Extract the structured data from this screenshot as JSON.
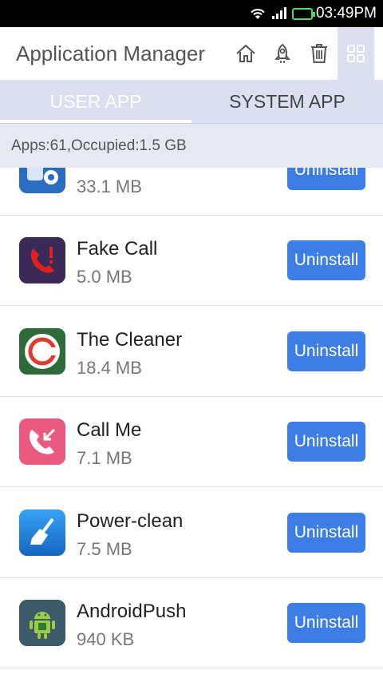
{
  "status_bar": {
    "time": "03:49PM"
  },
  "header": {
    "title": "Application Manager"
  },
  "tabs": [
    {
      "label": "USER APP",
      "active": true
    },
    {
      "label": "SYSTEM APP",
      "active": false
    }
  ],
  "summary": {
    "text": "Apps:61,Occupied:1.5 GB"
  },
  "apps": [
    {
      "name": "",
      "size": "33.1 MB",
      "button": "Uninstall",
      "icon": "blue-gear-app-icon"
    },
    {
      "name": "Fake Call",
      "size": "5.0 MB",
      "button": "Uninstall",
      "icon": "fake-call-icon"
    },
    {
      "name": "The Cleaner",
      "size": "18.4 MB",
      "button": "Uninstall",
      "icon": "cleaner-ring-icon"
    },
    {
      "name": "Call Me",
      "size": "7.1 MB",
      "button": "Uninstall",
      "icon": "call-me-phone-icon"
    },
    {
      "name": "Power-clean",
      "size": "7.5 MB",
      "button": "Uninstall",
      "icon": "broom-icon"
    },
    {
      "name": "AndroidPush",
      "size": "940 KB",
      "button": "Uninstall",
      "icon": "android-robot-icon"
    }
  ],
  "colors": {
    "accent": "#3d7ee6",
    "tab_bar": "#dcdff0",
    "status_bar": "#000000",
    "battery": "#4cd964"
  }
}
